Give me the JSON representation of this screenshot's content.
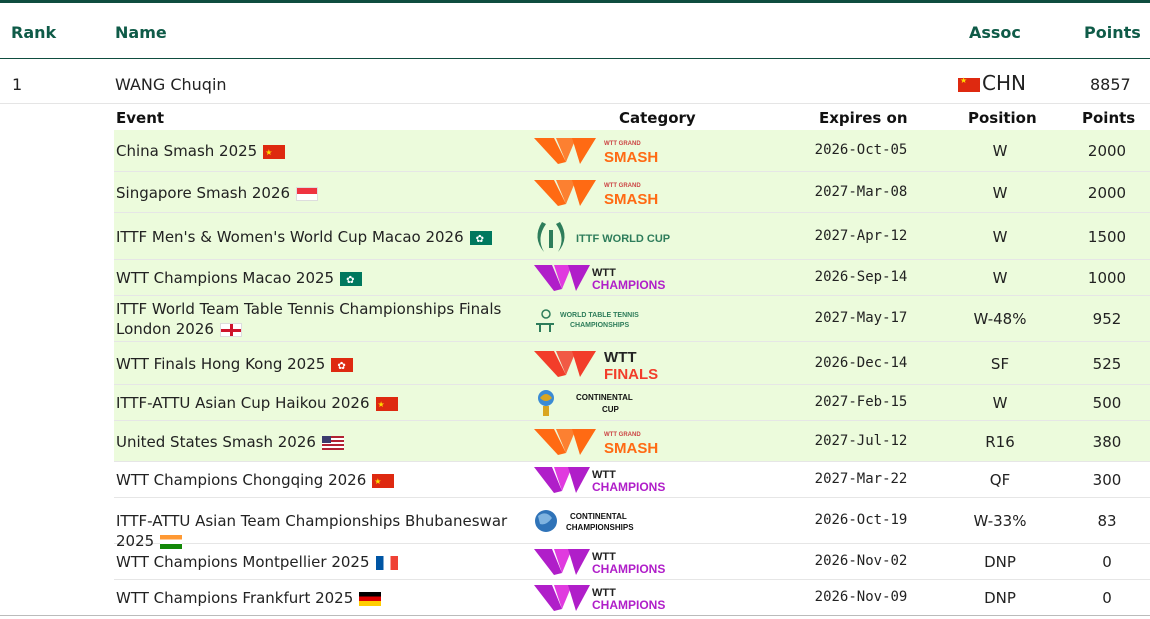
{
  "header": {
    "rank": "Rank",
    "name": "Name",
    "assoc": "Assoc",
    "points": "Points"
  },
  "player": {
    "rank": "1",
    "name": "WANG Chuqin",
    "assoc": "CHN",
    "points": "8857"
  },
  "subheader": {
    "event": "Event",
    "category": "Category",
    "expires": "Expires on",
    "position": "Position",
    "points": "Points"
  },
  "events": [
    {
      "name": "China Smash 2025",
      "flag": "chn",
      "logo": "smash",
      "expires": "2026-Oct-05",
      "position": "W",
      "points": "2000",
      "green": true
    },
    {
      "name": "Singapore Smash 2026",
      "flag": "sgp",
      "logo": "smash",
      "expires": "2027-Mar-08",
      "position": "W",
      "points": "2000",
      "green": true
    },
    {
      "name": "ITTF Men's & Women's World Cup Macao 2026",
      "flag": "mac",
      "logo": "worldcup",
      "expires": "2027-Apr-12",
      "position": "W",
      "points": "1500",
      "green": true
    },
    {
      "name": "WTT Champions Macao 2025",
      "flag": "mac",
      "logo": "champions",
      "expires": "2026-Sep-14",
      "position": "W",
      "points": "1000",
      "green": true
    },
    {
      "name": "ITTF World Team Table Tennis Championships Finals London 2026",
      "flag": "eng",
      "logo": "wttc",
      "expires": "2027-May-17",
      "position": "W-48%",
      "points": "952",
      "green": true
    },
    {
      "name": "WTT Finals Hong Kong 2025",
      "flag": "hkg",
      "logo": "finals",
      "expires": "2026-Dec-14",
      "position": "SF",
      "points": "525",
      "green": true
    },
    {
      "name": "ITTF-ATTU Asian Cup Haikou 2026",
      "flag": "chn",
      "logo": "contcup",
      "expires": "2027-Feb-15",
      "position": "W",
      "points": "500",
      "green": true
    },
    {
      "name": "United States Smash 2026",
      "flag": "usa",
      "logo": "smash",
      "expires": "2027-Jul-12",
      "position": "R16",
      "points": "380",
      "green": true
    },
    {
      "name": "WTT Champions Chongqing 2026",
      "flag": "chn",
      "logo": "champions",
      "expires": "2027-Mar-22",
      "position": "QF",
      "points": "300",
      "green": false
    },
    {
      "name": "ITTF-ATTU Asian Team Championships Bhubaneswar 2025",
      "flag": "ind",
      "logo": "contchamp",
      "expires": "2026-Oct-19",
      "position": "W-33%",
      "points": "83",
      "green": false
    },
    {
      "name": "WTT Champions Montpellier 2025",
      "flag": "fra",
      "logo": "champions",
      "expires": "2026-Nov-02",
      "position": "DNP",
      "points": "0",
      "green": false
    },
    {
      "name": "WTT Champions Frankfurt 2025",
      "flag": "deu",
      "logo": "champions",
      "expires": "2026-Nov-09",
      "position": "DNP",
      "points": "0",
      "green": false
    }
  ],
  "logos": {
    "smash": {
      "small": "WTT GRAND",
      "big": "SMASH"
    },
    "champions": {
      "small": "WTT",
      "big": "CHAMPIONS"
    },
    "finals": {
      "small": "WTT",
      "big": "FINALS"
    },
    "worldcup": {
      "big": "ITTF WORLD CUP"
    },
    "wttc": {
      "small": "WORLD TABLE TENNIS",
      "big": "CHAMPIONSHIPS"
    },
    "contcup": {
      "small": "CONTINENTAL",
      "big": "CUP"
    },
    "contchamp": {
      "small": "CONTINENTAL",
      "big": "CHAMPIONSHIPS"
    }
  },
  "colors": {
    "brand": "#0f4d3f",
    "highlight_row": "#ecfbdc",
    "smash": "#ff6a13",
    "champions": "#b01ec9"
  }
}
